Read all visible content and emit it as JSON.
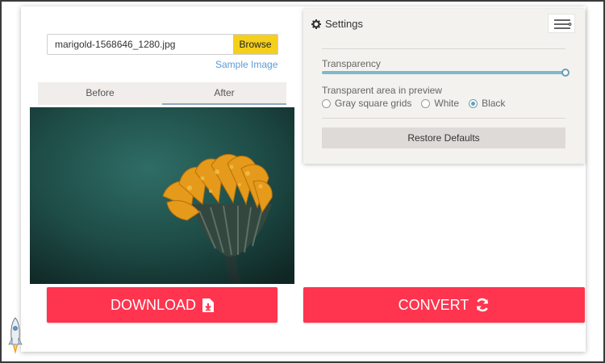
{
  "file": {
    "name": "marigold-1568646_1280.jpg",
    "browse_label": "Browse",
    "sample_link": "Sample Image"
  },
  "tabs": [
    {
      "label": "Before",
      "active": false
    },
    {
      "label": "After",
      "active": true
    }
  ],
  "preview": {
    "description_icon": "flower-photo"
  },
  "actions": {
    "download_label": "DOWNLOAD",
    "convert_label": "CONVERT"
  },
  "settings": {
    "title": "Settings",
    "transparency_label": "Transparency",
    "transparency_value": 1.0,
    "area_label": "Transparent area in preview",
    "options": [
      {
        "label": "Gray square grids",
        "checked": false
      },
      {
        "label": "White",
        "checked": false
      },
      {
        "label": "Black",
        "checked": true
      }
    ],
    "restore_label": "Restore Defaults"
  },
  "colors": {
    "accent": "#ff344e",
    "browse": "#f4cf1b",
    "slider": "#7fb8c9"
  }
}
